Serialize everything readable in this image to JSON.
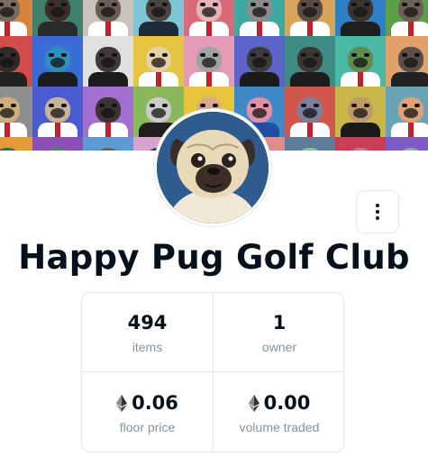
{
  "collection": {
    "title": "Happy Pug Golf Club"
  },
  "banner": {
    "tiles": [
      {
        "bg": "#d8833b",
        "head": "#7a6a5c",
        "body": "#ffffff"
      },
      {
        "bg": "#3f7f6b",
        "head": "#3a2f2a",
        "body": "#2a2a2a"
      },
      {
        "bg": "#c9c3bb",
        "head": "#6b5d52",
        "body": "#ffffff"
      },
      {
        "bg": "#7cc6d6",
        "head": "#4a4440",
        "body": "#1e2b3a"
      },
      {
        "bg": "#d86a7c",
        "head": "#e7b3b6",
        "body": "#ffffff"
      },
      {
        "bg": "#3fa9a0",
        "head": "#8c8c8c",
        "body": "#ffffff"
      },
      {
        "bg": "#d7a45c",
        "head": "#5c4b42",
        "body": "#ffffff"
      },
      {
        "bg": "#2f7fc4",
        "head": "#3a3330",
        "body": "#1f1f1f"
      },
      {
        "bg": "#5c9f47",
        "head": "#6e6055",
        "body": "#ffffff"
      },
      {
        "bg": "#d34b4b",
        "head": "#2f2a28",
        "body": "#222222"
      },
      {
        "bg": "#3b6bd6",
        "head": "#2b8fbf",
        "body": "#1d1d1d"
      },
      {
        "bg": "#e0e0e0",
        "head": "#3f3a37",
        "body": "#1c1c1c"
      },
      {
        "bg": "#e6c340",
        "head": "#e5cfa5",
        "body": "#ffffff"
      },
      {
        "bg": "#e39bb7",
        "head": "#9ea2a0",
        "body": "#ffffff"
      },
      {
        "bg": "#5c63c9",
        "head": "#3b3b3b",
        "body": "#1a1a1a"
      },
      {
        "bg": "#3e8b86",
        "head": "#3d3734",
        "body": "#1c1c1c"
      },
      {
        "bg": "#49b9a5",
        "head": "#5f8c4f",
        "body": "#ffffff"
      },
      {
        "bg": "#e2a06a",
        "head": "#5a4f48",
        "body": "#222222"
      },
      {
        "bg": "#8e8e8e",
        "head": "#cfb07a",
        "body": "#ffffff"
      },
      {
        "bg": "#4b5bd0",
        "head": "#c6b398",
        "body": "#ffffff"
      },
      {
        "bg": "#a26fd1",
        "head": "#3b3633",
        "body": "#ffffff"
      },
      {
        "bg": "#8ab65c",
        "head": "#cbcaca",
        "body": "#1f1f1f"
      },
      {
        "bg": "#e8c43d",
        "head": "#d8a98e",
        "body": "#ffffff"
      },
      {
        "bg": "#3f89c6",
        "head": "#e38fa9",
        "body": "#1e4fa3"
      },
      {
        "bg": "#d1564b",
        "head": "#7d7e9b",
        "body": "#ffffff"
      },
      {
        "bg": "#c9b74a",
        "head": "#c09a68",
        "body": "#1a1a1a"
      },
      {
        "bg": "#6aa3b5",
        "head": "#e0a07a",
        "body": "#ffffff"
      },
      {
        "bg": "#e59b36",
        "head": "#3c6a5a",
        "body": "#1b1b1b"
      },
      {
        "bg": "#8b4fb5",
        "head": "#4a8a5a",
        "body": "#2d2d2d"
      },
      {
        "bg": "#5c9bd3",
        "head": "#6a635e",
        "body": "#ffffff"
      },
      {
        "bg": "#d6a3cf",
        "head": "#3a3532",
        "body": "#222222"
      },
      {
        "bg": "#3f9f8b",
        "head": "#cfc5b4",
        "body": "#ffffff"
      },
      {
        "bg": "#e08c8c",
        "head": "#d9a98a",
        "body": "#ffffff"
      },
      {
        "bg": "#5f7d9b",
        "head": "#8fc2a0",
        "body": "#ffffff"
      },
      {
        "bg": "#c93d55",
        "head": "#bf7a90",
        "body": "#2e2e2e"
      },
      {
        "bg": "#7e5ac4",
        "head": "#8ea0b8",
        "body": "#ffffff"
      }
    ]
  },
  "actions": {
    "more_icon": "vertical-dots-icon"
  },
  "stats": {
    "items": {
      "value": "494",
      "label": "items"
    },
    "owners": {
      "value": "1",
      "label": "owner"
    },
    "floor_price": {
      "value": "0.06",
      "label": "floor price",
      "icon": "ethereum-icon"
    },
    "volume_traded": {
      "value": "0.00",
      "label": "volume traded",
      "icon": "ethereum-icon"
    }
  },
  "colors": {
    "text_primary": "#04111d",
    "text_secondary": "#8a939b",
    "border": "#e5e8eb",
    "avatar_bg": "#2f5c8f"
  }
}
